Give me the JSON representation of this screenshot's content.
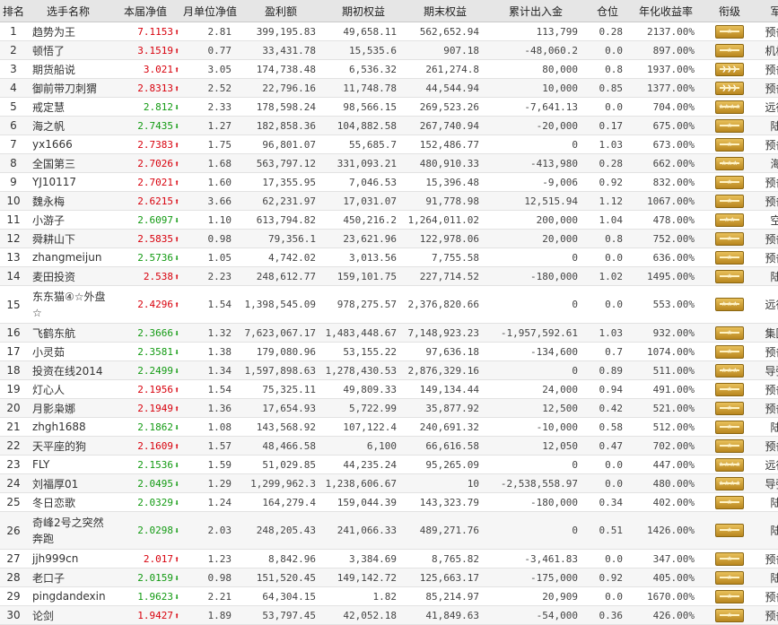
{
  "headers": [
    "排名",
    "选手名称",
    "本届净值",
    "月单位净值",
    "盈利额",
    "期初权益",
    "期末权益",
    "累计出入金",
    "仓位",
    "年化收益率",
    "衔级",
    "军种"
  ],
  "rows": [
    {
      "rank": "1",
      "name": "趋势为王",
      "net": "7.1153",
      "dir": "up",
      "unit": "2.81",
      "profit": "399,195.83",
      "begin": "49,658.11",
      "end": "562,652.94",
      "flow": "113,799",
      "pos": "0.28",
      "annual": "2137.00%",
      "rank_icon": "rank-insignia-one-star",
      "branch": "预备役"
    },
    {
      "rank": "2",
      "name": "顿悟了",
      "net": "3.1519",
      "dir": "up",
      "unit": "0.77",
      "profit": "33,431.78",
      "begin": "15,535.6",
      "end": "907.18",
      "flow": "-48,060.2",
      "pos": "0.0",
      "annual": "897.00%",
      "rank_icon": "rank-insignia-one-star",
      "branch": "机枪手"
    },
    {
      "rank": "3",
      "name": "期货船说",
      "net": "3.021",
      "dir": "up",
      "unit": "3.05",
      "profit": "174,738.48",
      "begin": "6,536.32",
      "end": "261,274.8",
      "flow": "80,000",
      "pos": "0.8",
      "annual": "1937.00%",
      "rank_icon": "rank-insignia-chevrons",
      "branch": "预备役"
    },
    {
      "rank": "4",
      "name": "御前带刀刺猬",
      "net": "2.8313",
      "dir": "up",
      "unit": "2.52",
      "profit": "22,796.16",
      "begin": "11,748.78",
      "end": "44,544.94",
      "flow": "10,000",
      "pos": "0.85",
      "annual": "1377.00%",
      "rank_icon": "rank-insignia-chevrons",
      "branch": "预备役"
    },
    {
      "rank": "5",
      "name": "戒定慧",
      "net": "2.812",
      "dir": "dn",
      "unit": "2.33",
      "profit": "178,598.24",
      "begin": "98,566.15",
      "end": "269,523.26",
      "flow": "-7,641.13",
      "pos": "0.0",
      "annual": "704.00%",
      "rank_icon": "rank-insignia-four-stars",
      "branch": "远征军"
    },
    {
      "rank": "6",
      "name": "海之帆",
      "net": "2.7435",
      "dir": "dn",
      "unit": "1.27",
      "profit": "182,858.36",
      "begin": "104,882.58",
      "end": "267,740.94",
      "flow": "-20,000",
      "pos": "0.17",
      "annual": "675.00%",
      "rank_icon": "rank-insignia-one-star",
      "branch": "陆军"
    },
    {
      "rank": "7",
      "name": "yx1666",
      "net": "2.7383",
      "dir": "up",
      "unit": "1.75",
      "profit": "96,801.07",
      "begin": "55,685.7",
      "end": "152,486.77",
      "flow": "0",
      "pos": "1.03",
      "annual": "673.00%",
      "rank_icon": "rank-insignia-one-star",
      "branch": "预备役"
    },
    {
      "rank": "8",
      "name": "全国第三",
      "net": "2.7026",
      "dir": "up",
      "unit": "1.68",
      "profit": "563,797.12",
      "begin": "331,093.21",
      "end": "480,910.33",
      "flow": "-413,980",
      "pos": "0.28",
      "annual": "662.00%",
      "rank_icon": "rank-insignia-three-stars",
      "branch": "海军"
    },
    {
      "rank": "9",
      "name": "YJ10117",
      "net": "2.7021",
      "dir": "up",
      "unit": "1.60",
      "profit": "17,355.95",
      "begin": "7,046.53",
      "end": "15,396.48",
      "flow": "-9,006",
      "pos": "0.92",
      "annual": "832.00%",
      "rank_icon": "rank-insignia-one-star",
      "branch": "预备役"
    },
    {
      "rank": "10",
      "name": "魏永梅",
      "net": "2.6215",
      "dir": "up",
      "unit": "3.66",
      "profit": "62,231.97",
      "begin": "17,031.07",
      "end": "91,778.98",
      "flow": "12,515.94",
      "pos": "1.12",
      "annual": "1067.00%",
      "rank_icon": "rank-insignia-one-star",
      "branch": "预备役"
    },
    {
      "rank": "11",
      "name": "小游子",
      "net": "2.6097",
      "dir": "dn",
      "unit": "1.10",
      "profit": "613,794.82",
      "begin": "450,216.2",
      "end": "1,264,011.02",
      "flow": "200,000",
      "pos": "1.04",
      "annual": "478.00%",
      "rank_icon": "rank-insignia-two-stars",
      "branch": "空军"
    },
    {
      "rank": "12",
      "name": "舜耕山下",
      "net": "2.5835",
      "dir": "up",
      "unit": "0.98",
      "profit": "79,356.1",
      "begin": "23,621.96",
      "end": "122,978.06",
      "flow": "20,000",
      "pos": "0.8",
      "annual": "752.00%",
      "rank_icon": "rank-insignia-one-star",
      "branch": "预备役"
    },
    {
      "rank": "13",
      "name": "zhangmeijun",
      "net": "2.5736",
      "dir": "dn",
      "unit": "1.05",
      "profit": "4,742.02",
      "begin": "3,013.56",
      "end": "7,755.58",
      "flow": "0",
      "pos": "0.0",
      "annual": "636.00%",
      "rank_icon": "rank-insignia-one-star",
      "branch": "预备役"
    },
    {
      "rank": "14",
      "name": "麦田投资",
      "net": "2.538",
      "dir": "up",
      "unit": "2.23",
      "profit": "248,612.77",
      "begin": "159,101.75",
      "end": "227,714.52",
      "flow": "-180,000",
      "pos": "1.02",
      "annual": "1495.00%",
      "rank_icon": "rank-insignia-one-star",
      "branch": "陆军"
    },
    {
      "rank": "15",
      "name": "东东猫④☆外盘☆",
      "net": "2.4296",
      "dir": "up",
      "unit": "1.54",
      "profit": "1,398,545.09",
      "begin": "978,275.57",
      "end": "2,376,820.66",
      "flow": "0",
      "pos": "0.0",
      "annual": "553.00%",
      "rank_icon": "rank-insignia-three-stars",
      "branch": "远征军",
      "tall": true
    },
    {
      "rank": "16",
      "name": "飞鹤东航",
      "net": "2.3666",
      "dir": "dn",
      "unit": "1.32",
      "profit": "7,623,067.17",
      "begin": "1,483,448.67",
      "end": "7,148,923.23",
      "flow": "-1,957,592.61",
      "pos": "1.03",
      "annual": "932.00%",
      "rank_icon": "rank-insignia-one-star",
      "branch": "集团军"
    },
    {
      "rank": "17",
      "name": "小灵茹",
      "net": "2.3581",
      "dir": "dn",
      "unit": "1.38",
      "profit": "179,080.96",
      "begin": "53,155.22",
      "end": "97,636.18",
      "flow": "-134,600",
      "pos": "0.7",
      "annual": "1074.00%",
      "rank_icon": "rank-insignia-one-star",
      "branch": "预备役"
    },
    {
      "rank": "18",
      "name": "投资在线2014",
      "net": "2.2499",
      "dir": "dn",
      "unit": "1.34",
      "profit": "1,597,898.63",
      "begin": "1,278,430.53",
      "end": "2,876,329.16",
      "flow": "0",
      "pos": "0.89",
      "annual": "511.00%",
      "rank_icon": "rank-insignia-three-stars",
      "branch": "导弹部"
    },
    {
      "rank": "19",
      "name": "灯心人",
      "net": "2.1956",
      "dir": "up",
      "unit": "1.54",
      "profit": "75,325.11",
      "begin": "49,809.33",
      "end": "149,134.44",
      "flow": "24,000",
      "pos": "0.94",
      "annual": "491.00%",
      "rank_icon": "rank-insignia-one-star",
      "branch": "预备役"
    },
    {
      "rank": "20",
      "name": "月影枭娜",
      "net": "2.1949",
      "dir": "up",
      "unit": "1.36",
      "profit": "17,654.93",
      "begin": "5,722.99",
      "end": "35,877.92",
      "flow": "12,500",
      "pos": "0.42",
      "annual": "521.00%",
      "rank_icon": "rank-insignia-one-star",
      "branch": "预备役"
    },
    {
      "rank": "21",
      "name": "zhgh1688",
      "net": "2.1862",
      "dir": "dn",
      "unit": "1.08",
      "profit": "143,568.92",
      "begin": "107,122.4",
      "end": "240,691.32",
      "flow": "-10,000",
      "pos": "0.58",
      "annual": "512.00%",
      "rank_icon": "rank-insignia-one-star",
      "branch": "陆军"
    },
    {
      "rank": "22",
      "name": "天平座的狗",
      "net": "2.1609",
      "dir": "up",
      "unit": "1.57",
      "profit": "48,466.58",
      "begin": "6,100",
      "end": "66,616.58",
      "flow": "12,050",
      "pos": "0.47",
      "annual": "702.00%",
      "rank_icon": "rank-insignia-one-star",
      "branch": "预备役"
    },
    {
      "rank": "23",
      "name": "FLY",
      "net": "2.1536",
      "dir": "dn",
      "unit": "1.59",
      "profit": "51,029.85",
      "begin": "44,235.24",
      "end": "95,265.09",
      "flow": "0",
      "pos": "0.0",
      "annual": "447.00%",
      "rank_icon": "rank-insignia-four-stars",
      "branch": "远征军"
    },
    {
      "rank": "24",
      "name": "刘福厚01",
      "net": "2.0495",
      "dir": "dn",
      "unit": "1.29",
      "profit": "1,299,962.3",
      "begin": "1,238,606.67",
      "end": "10",
      "flow": "-2,538,558.97",
      "pos": "0.0",
      "annual": "480.00%",
      "rank_icon": "rank-insignia-four-stars",
      "branch": "导弹部"
    },
    {
      "rank": "25",
      "name": "冬日恋歌",
      "net": "2.0329",
      "dir": "dn",
      "unit": "1.24",
      "profit": "164,279.4",
      "begin": "159,044.39",
      "end": "143,323.79",
      "flow": "-180,000",
      "pos": "0.34",
      "annual": "402.00%",
      "rank_icon": "rank-insignia-one-star",
      "branch": "陆军"
    },
    {
      "rank": "26",
      "name": "奇峰2号之突然奔跑",
      "net": "2.0298",
      "dir": "dn",
      "unit": "2.03",
      "profit": "248,205.43",
      "begin": "241,066.33",
      "end": "489,271.76",
      "flow": "0",
      "pos": "0.51",
      "annual": "1426.00%",
      "rank_icon": "rank-insignia-one-star",
      "branch": "陆军",
      "tall": true
    },
    {
      "rank": "27",
      "name": "jjh999cn",
      "net": "2.017",
      "dir": "up",
      "unit": "1.23",
      "profit": "8,842.96",
      "begin": "3,384.69",
      "end": "8,765.82",
      "flow": "-3,461.83",
      "pos": "0.0",
      "annual": "347.00%",
      "rank_icon": "rank-insignia-one-star",
      "branch": "预备役"
    },
    {
      "rank": "28",
      "name": "老口子",
      "net": "2.0159",
      "dir": "dn",
      "unit": "0.98",
      "profit": "151,520.45",
      "begin": "149,142.72",
      "end": "125,663.17",
      "flow": "-175,000",
      "pos": "0.92",
      "annual": "405.00%",
      "rank_icon": "rank-insignia-one-star",
      "branch": "陆军"
    },
    {
      "rank": "29",
      "name": "pingdandexin",
      "net": "1.9623",
      "dir": "dn",
      "unit": "2.21",
      "profit": "64,304.15",
      "begin": "1.82",
      "end": "85,214.97",
      "flow": "20,909",
      "pos": "0.0",
      "annual": "1670.00%",
      "rank_icon": "rank-insignia-one-star",
      "branch": "预备役"
    },
    {
      "rank": "30",
      "name": "论剑",
      "net": "1.9427",
      "dir": "up",
      "unit": "1.89",
      "profit": "53,797.45",
      "begin": "42,052.18",
      "end": "41,849.63",
      "flow": "-54,000",
      "pos": "0.36",
      "annual": "426.00%",
      "rank_icon": "rank-insignia-one-star",
      "branch": "预备役"
    }
  ],
  "colors": {
    "up": "#d8000c",
    "down": "#129a12",
    "header_bg": "#e6e6e6",
    "badge": "#c99a2e"
  }
}
